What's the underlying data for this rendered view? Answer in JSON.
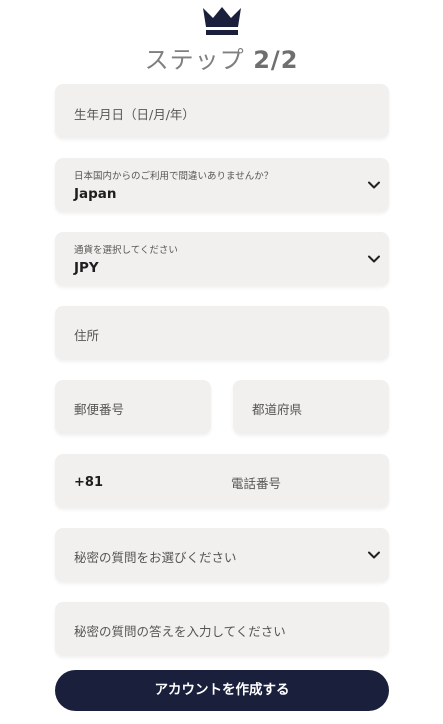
{
  "header": {
    "step_label": "ステップ",
    "step_number": "2/2"
  },
  "form": {
    "birthdate_placeholder": "生年月日（日/月/年）",
    "residence_label": "日本国内からのご利用で間違いありませんか？",
    "residence_value": "Japan",
    "currency_label": "通貨を選択してください",
    "currency_value": "JPY",
    "address_placeholder": "住所",
    "postal_placeholder": "郵便番号",
    "prefecture_placeholder": "都道府県",
    "phone_prefix": "+81",
    "phone_placeholder": "電話番号",
    "secret_question_placeholder": "秘密の質問をお選びください",
    "secret_answer_placeholder": "秘密の質問の答えを入力してください"
  },
  "submit_label": "アカウントを作成する",
  "colors": {
    "field_bg": "#f2f0ee",
    "brand_navy": "#1a1f3c"
  }
}
